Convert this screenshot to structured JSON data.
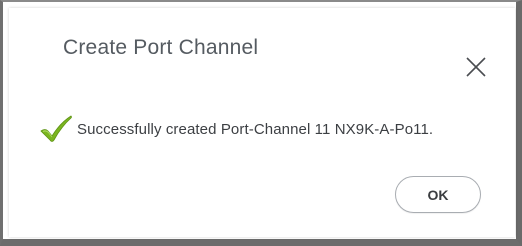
{
  "dialog": {
    "title": "Create Port Channel",
    "message": "Successfully created Port-Channel 11 NX9K-A-Po11.",
    "ok_label": "OK",
    "close_icon": "close-icon",
    "status_icon": "check-icon"
  },
  "colors": {
    "check_green": "#7bb51f",
    "title_text": "#555b61",
    "message_text": "#3c3f43"
  }
}
